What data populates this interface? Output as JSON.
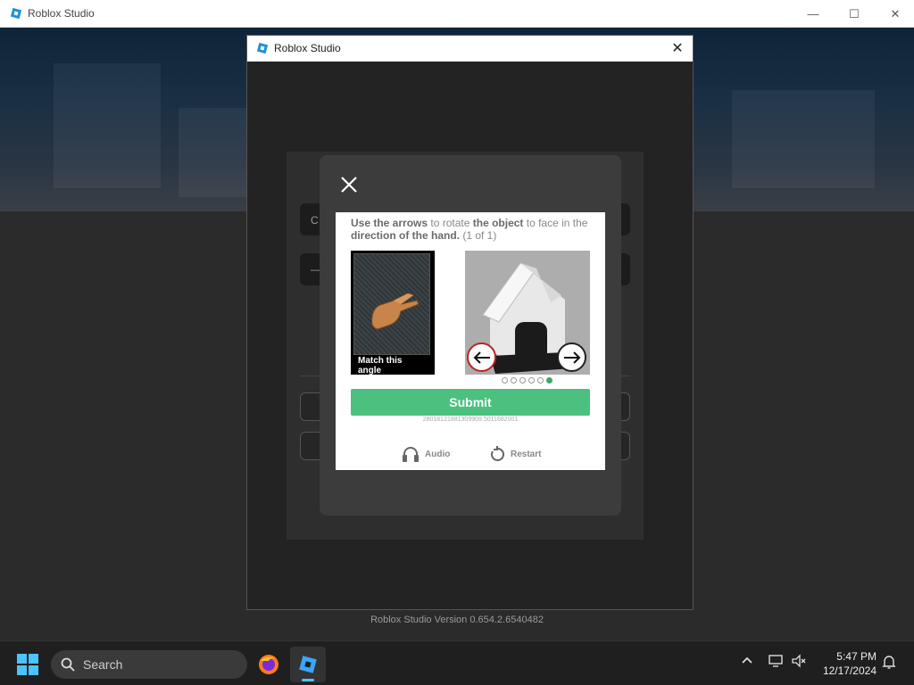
{
  "window": {
    "title": "Roblox Studio",
    "controls": {
      "minimize": "—",
      "maximize": "☐",
      "close": "✕"
    }
  },
  "dialog": {
    "title": "Roblox Studio",
    "close": "✕"
  },
  "login_form_partial": {
    "field1_fragment": "C",
    "field2_fragment": "—"
  },
  "captcha": {
    "instruction_parts": [
      "Use the arrows",
      " to rotate ",
      "the object",
      " to face in the ",
      "direction of the hand.",
      " (1 of 1)"
    ],
    "reference_caption": "Match this angle",
    "progress": {
      "total": 6,
      "current": 6
    },
    "submit_label": "Submit",
    "session_id": "28018121881309909.5011682001",
    "audio_label": "Audio",
    "restart_label": "Restart",
    "accent_color": "#4cc17f"
  },
  "version": "Roblox Studio Version 0.654.2.6540482",
  "taskbar": {
    "search_placeholder": "Search",
    "time": "5:47 PM",
    "date": "12/17/2024"
  }
}
